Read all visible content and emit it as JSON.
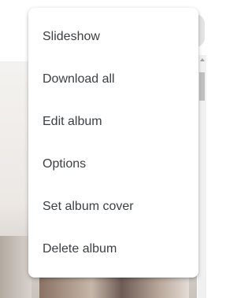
{
  "menu": {
    "items": [
      {
        "label": "Slideshow"
      },
      {
        "label": "Download all"
      },
      {
        "label": "Edit album"
      },
      {
        "label": "Options"
      },
      {
        "label": "Set album cover"
      },
      {
        "label": "Delete album"
      }
    ]
  }
}
